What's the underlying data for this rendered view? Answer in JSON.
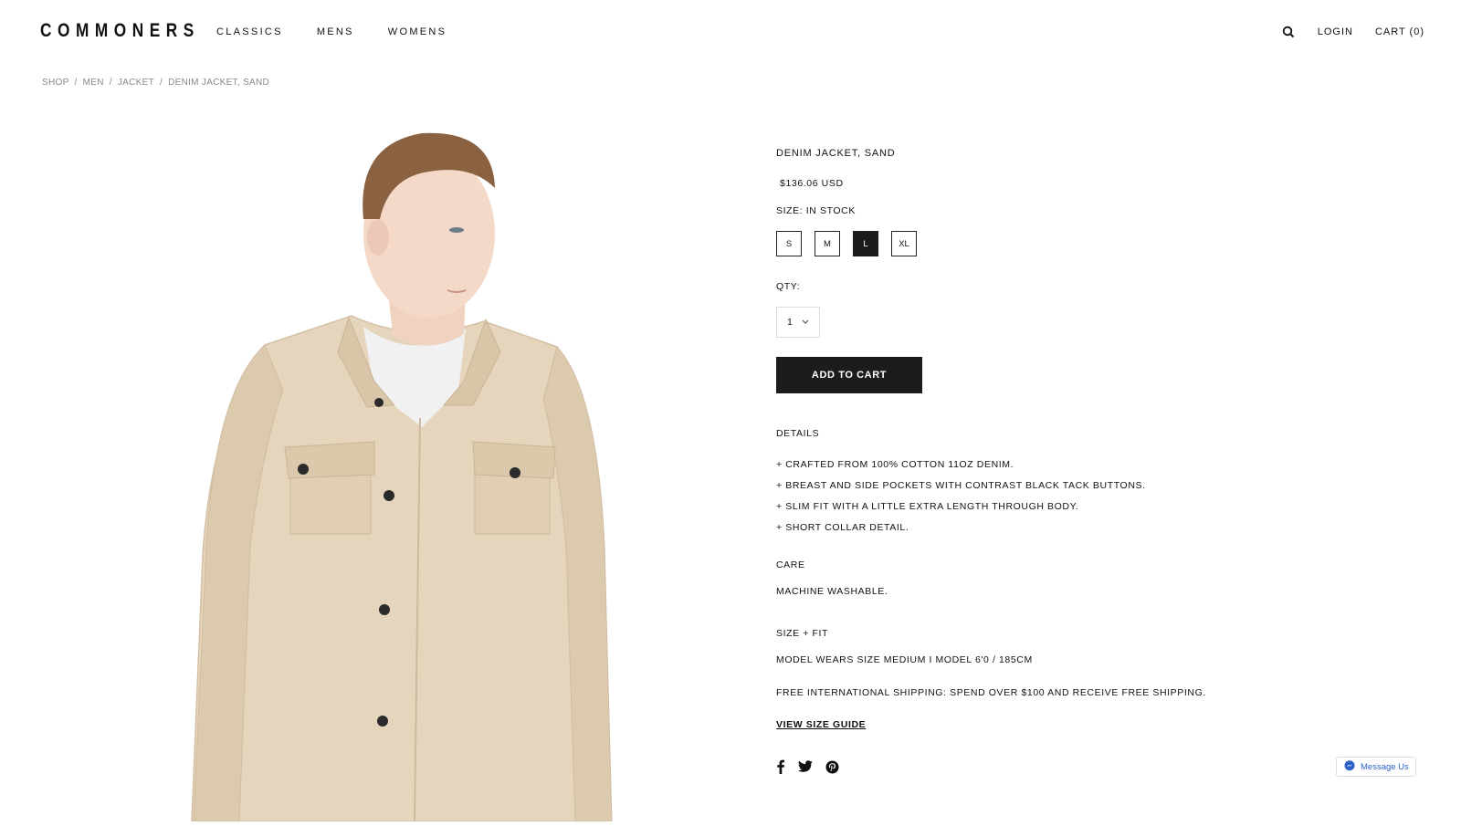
{
  "header": {
    "logo": "COMMONERS",
    "nav": [
      "CLASSICS",
      "MENS",
      "WOMENS"
    ],
    "login": "LOGIN",
    "cart": "CART (0)"
  },
  "breadcrumb": [
    "SHOP",
    "MEN",
    "JACKET",
    "DENIM JACKET, SAND"
  ],
  "product": {
    "title": "DENIM JACKET, SAND",
    "price": "$136.06 USD",
    "size_label": "SIZE: IN STOCK",
    "sizes": [
      "S",
      "M",
      "L",
      "XL"
    ],
    "selected_size": "L",
    "qty_label": "QTY:",
    "qty_value": "1",
    "add_to_cart": "ADD TO CART",
    "details_heading": "DETAILS",
    "details": [
      "+ CRAFTED FROM 100% COTTON 11OZ DENIM.",
      "+ BREAST AND SIDE POCKETS WITH CONTRAST BLACK TACK BUTTONS.",
      "+ SLIM FIT WITH A LITTLE EXTRA LENGTH THROUGH BODY.",
      "+ SHORT COLLAR DETAIL."
    ],
    "care_heading": "CARE",
    "care_text": "MACHINE WASHABLE.",
    "fit_heading": "SIZE + FIT",
    "fit_text": "MODEL WEARS SIZE MEDIUM I MODEL 6'0 / 185CM",
    "shipping_text": "FREE INTERNATIONAL SHIPPING: SPEND OVER $100 AND RECEIVE FREE SHIPPING.",
    "size_guide": "VIEW SIZE GUIDE"
  },
  "social_icons": [
    "facebook-icon",
    "twitter-icon",
    "pinterest-icon"
  ],
  "messenger": {
    "label": "Message Us"
  },
  "colors": {
    "button_dark": "#1d1b1c",
    "jacket": "#e6d5bd",
    "messenger_blue": "#2f62c9"
  }
}
